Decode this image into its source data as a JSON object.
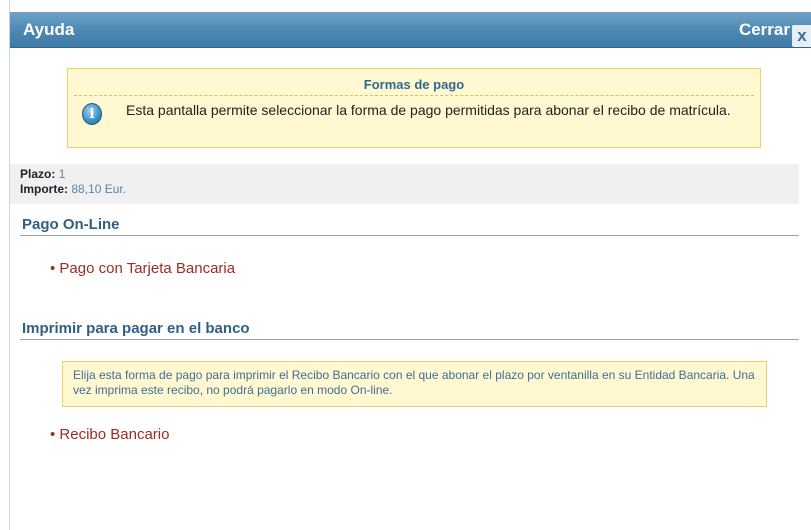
{
  "dialog": {
    "title": "Ayuda",
    "close_label": "Cerrar",
    "close_icon_glyph": "x"
  },
  "info_box": {
    "title": "Formas de pago",
    "icon": "info-icon",
    "icon_glyph": "i",
    "text": "Esta pantalla permite seleccionar la forma de pago permitidas para abonar el recibo de matrícula."
  },
  "summary": {
    "plazo_label": "Plazo:",
    "plazo_value": "1",
    "importe_label": "Importe:",
    "importe_value": "88,10 Eur."
  },
  "online": {
    "heading": "Pago On-Line",
    "link": "• Pago con Tarjeta Bancaria"
  },
  "bank": {
    "heading": "Imprimir para pagar en el banco",
    "note": "Elija esta forma de pago para imprimir el Recibo Bancario con el que abonar el plazo por ventanilla en su Entidad Bancaria. Una vez imprima este recibo, no podrá pagarlo en modo On-line.",
    "link": "• Recibo Bancario"
  },
  "colors": {
    "titlebar": "#4f8ab5",
    "link": "#9b2d22",
    "heading": "#2f5f86",
    "note_bg": "#fff8d1"
  }
}
